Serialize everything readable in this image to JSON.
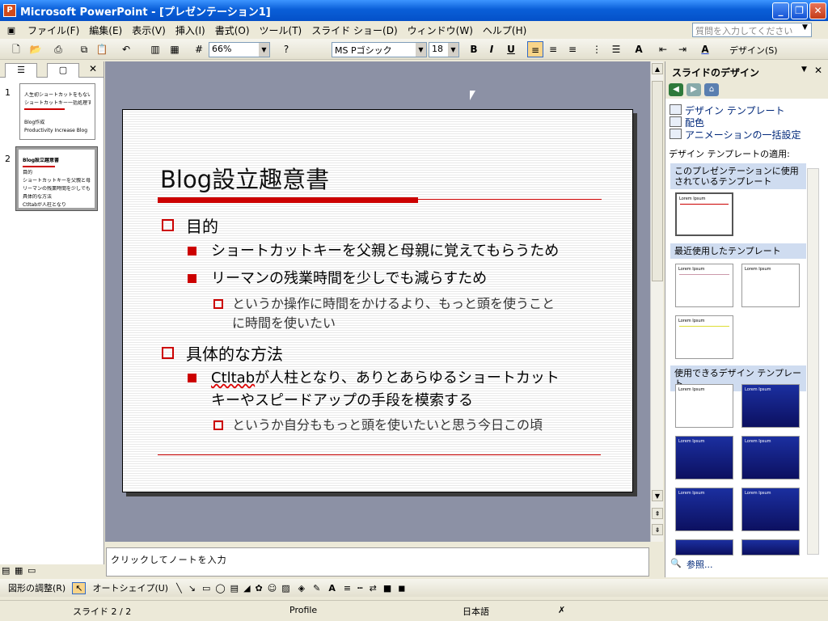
{
  "window": {
    "title": "Microsoft PowerPoint - [プレゼンテーション1]",
    "min": "_",
    "max": "❐",
    "close": "✕"
  },
  "menu": [
    "ファイル(F)",
    "編集(E)",
    "表示(V)",
    "挿入(I)",
    "書式(O)",
    "ツール(T)",
    "スライド ショー(D)",
    "ウィンドウ(W)",
    "ヘルプ(H)"
  ],
  "help_box_placeholder": "質問を入力してください",
  "toolbar": {
    "zoom": "66%",
    "font": "MS Pゴシック",
    "size": "18",
    "bold": "B",
    "italic": "I",
    "underline": "U",
    "design_label": "デザイン(S)",
    "grow_font": "A",
    "font_color": "A"
  },
  "outline_tabs": {
    "close": "✕"
  },
  "slides": [
    {
      "num": "1",
      "lines": [
        "人生初ショートカットをもないすぎ",
        "ショートカットキー一括処理する",
        "Blog作成",
        "Productivity Increase Blog"
      ]
    },
    {
      "num": "2",
      "lines": [
        "Blog設立趣意書",
        "目的",
        "ショートカットキーを父親と母親に覚えてもらうため",
        "リーマンの残業時間を少しでも減らすため",
        "具体的な方法",
        "Ctltabが人柱となり"
      ]
    }
  ],
  "slide": {
    "title": "Blog設立趣意書",
    "b1": "目的",
    "b1_1": "ショートカットキーを父親と母親に覚えてもらうため",
    "b1_2": "リーマンの残業時間を少しでも減らすため",
    "b1_2_1a": "というか操作に時間をかけるより、もっと頭を使うこと",
    "b1_2_1b": "に時間を使いたい",
    "b2": "具体的な方法",
    "b2_1_wavy": "Ctltab",
    "b2_1a": "が人柱となり、ありとあらゆるショートカット",
    "b2_1b": "キーやスピードアップの手段を模索する",
    "b2_1_1": "というか自分ももっと頭を使いたいと思う今日この頃"
  },
  "notes_placeholder": "クリックしてノートを入力",
  "taskpane": {
    "title": "スライドのデザイン",
    "links": [
      "デザイン テンプレート",
      "配色",
      "アニメーションの一括設定"
    ],
    "apply_label": "デザイン テンプレートの適用:",
    "sec_used": "このプレゼンテーションに使用されているテンプレート",
    "sec_recent": "最近使用したテンプレート",
    "sec_available": "使用できるデザイン テンプレート",
    "template_text": "Lorem Ipsum",
    "browse": "参照..."
  },
  "drawbar": {
    "draw": "図形の調整(R)",
    "autoshape": "オートシェイプ(U)"
  },
  "status": {
    "slide": "スライド 2 / 2",
    "design": "Profile",
    "lang": "日本語"
  }
}
